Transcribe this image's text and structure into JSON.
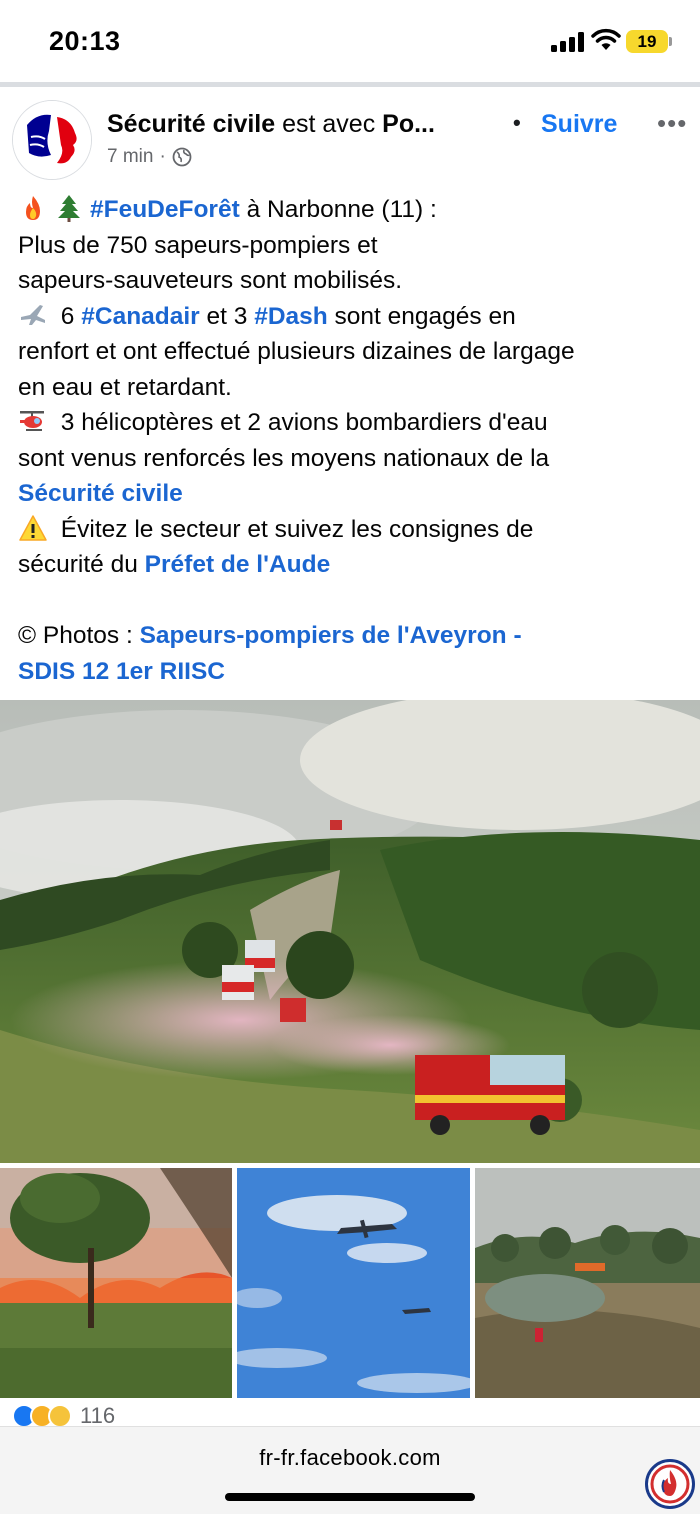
{
  "status_bar": {
    "time": "20:13",
    "battery": "19",
    "icons": [
      "signal-icon",
      "wifi-icon",
      "battery-icon"
    ]
  },
  "post": {
    "page_name": "Sécurité civile",
    "with_text": " est avec ",
    "with_name": "Po...",
    "follow_label": "Suivre",
    "more_label": "•••",
    "time_ago": "7 min",
    "meta_sep": "·",
    "audience_icon": "globe-icon",
    "text": {
      "l1_hashtag": "#FeuDeForêt",
      "l1_rest": " à Narbonne (11) :",
      "l2": "Plus de 750 sapeurs-pompiers et",
      "l3": "sapeurs-sauveteurs sont mobilisés.",
      "l4_pre": " 6 ",
      "l4_tag1": "#Canadair",
      "l4_mid": " et 3 ",
      "l4_tag2": "#Dash",
      "l4_post": " sont engagés en",
      "l5": "renfort et ont effectué plusieurs dizaines de largage",
      "l6": "en eau et retardant.",
      "l7": " 3 hélicoptères et 2 avions bombardiers d'eau",
      "l8": "sont venus renforcés les moyens nationaux de la",
      "l9_link": "Sécurité civile",
      "l10": " Évitez le secteur et suivez les consignes de",
      "l11_pre": "sécurité du ",
      "l11_link": "Préfet de l'Aude",
      "l12_pre": "© Photos : ",
      "l12_link": "Sapeurs-pompiers de l'Aveyron -",
      "l13_link": "SDIS 12 1er RIISC"
    },
    "reactions": {
      "count": "116",
      "icons": [
        "like-icon",
        "care-icon",
        "sad-icon"
      ]
    }
  },
  "browser": {
    "url": "fr-fr.facebook.com"
  },
  "colors": {
    "link": "#1b66d1",
    "follow": "#1877f2",
    "battery": "#f7d82d"
  }
}
